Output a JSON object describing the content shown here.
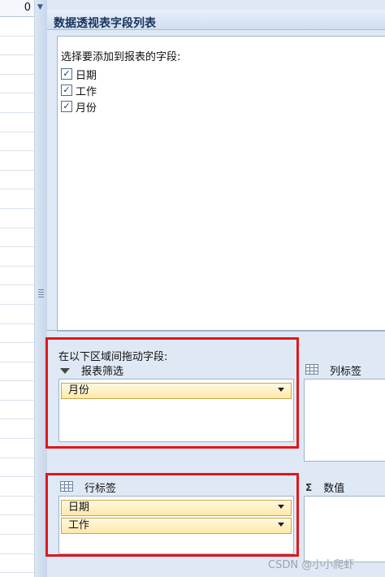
{
  "sheet": {
    "cell_value": "0"
  },
  "pane": {
    "title": "数据透视表字段列表",
    "prompt": "选择要添加到报表的字段:",
    "fields": [
      {
        "label": "日期",
        "checked": true
      },
      {
        "label": "工作",
        "checked": true
      },
      {
        "label": "月份",
        "checked": true
      }
    ],
    "drag_hint": "在以下区域间拖动字段:",
    "zones": {
      "report_filter": {
        "label": "报表筛选",
        "icon": "filter-icon",
        "items": [
          "月份"
        ]
      },
      "column_labels": {
        "label": "列标签",
        "icon": "grid-icon",
        "items": []
      },
      "row_labels": {
        "label": "行标签",
        "icon": "grid-icon",
        "items": [
          "日期",
          "工作"
        ]
      },
      "values": {
        "label": "数值",
        "icon": "sigma-icon",
        "items": []
      }
    }
  },
  "highlight_color": "#e0171b",
  "watermark": "CSDN @小小爬虾"
}
